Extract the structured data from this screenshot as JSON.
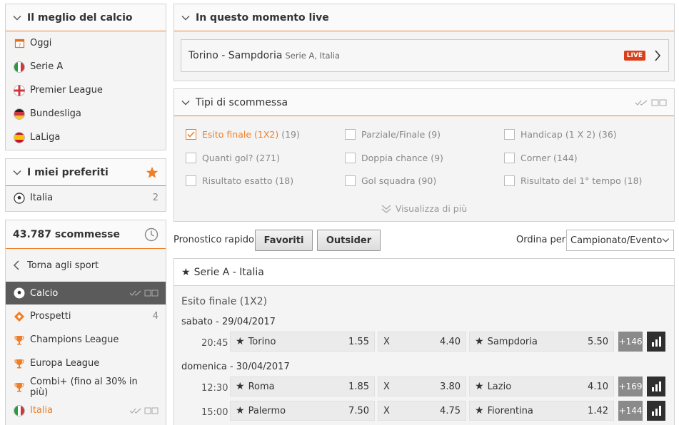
{
  "sidebar": {
    "best": {
      "title": "Il meglio del calcio",
      "items": [
        {
          "label": "Oggi",
          "icon": "calendar-icon"
        },
        {
          "label": "Serie A",
          "icon": "italy-flag-icon"
        },
        {
          "label": "Premier League",
          "icon": "england-flag-icon"
        },
        {
          "label": "Bundesliga",
          "icon": "germany-flag-icon"
        },
        {
          "label": "LaLiga",
          "icon": "spain-flag-icon"
        }
      ]
    },
    "favorites": {
      "title": "I miei preferiti",
      "items": [
        {
          "label": "Italia",
          "count": "2",
          "icon": "soccer-ball-icon"
        }
      ]
    },
    "sports": {
      "title": "43.787 scommesse",
      "back_label": "Torna agli sport",
      "active_label": "Calcio",
      "items": [
        {
          "label": "Prospetti",
          "count": "4",
          "icon": "prospetti-icon"
        },
        {
          "label": "Champions League",
          "count": "",
          "icon": "trophy-icon"
        },
        {
          "label": "Europa League",
          "count": "",
          "icon": "trophy-icon"
        },
        {
          "label": "Combi+ (fino al 30% in più)",
          "count": "",
          "icon": "trophy-icon"
        },
        {
          "label": "Italia",
          "count": "",
          "icon": "italy-flag-icon"
        }
      ]
    }
  },
  "live": {
    "title": "In questo momento live",
    "event": "Torino - Sampdoria",
    "league": "Serie A, Italia",
    "badge": "LIVE"
  },
  "bet_types": {
    "title": "Tipi di scommessa",
    "markets": [
      {
        "label": "Esito finale (1X2)",
        "count": "(19)",
        "checked": true
      },
      {
        "label": "Parziale/Finale",
        "count": "(9)",
        "checked": false
      },
      {
        "label": "Handicap (1 X 2)",
        "count": "(36)",
        "checked": false
      },
      {
        "label": "Quanti gol?",
        "count": "(271)",
        "checked": false
      },
      {
        "label": "Doppia chance",
        "count": "(9)",
        "checked": false
      },
      {
        "label": "Corner",
        "count": "(144)",
        "checked": false
      },
      {
        "label": "Risultato esatto",
        "count": "(18)",
        "checked": false
      },
      {
        "label": "Gol squadra",
        "count": "(90)",
        "checked": false
      },
      {
        "label": "Risultato del 1° tempo",
        "count": "(18)",
        "checked": false
      }
    ],
    "show_more": "Visualizza di più"
  },
  "toolbar": {
    "quick_label": "Pronostico rapido",
    "favorites_btn": "Favoriti",
    "outsider_btn": "Outsider",
    "sort_label": "Ordina per",
    "sort_value": "Campionato/Evento"
  },
  "league_block": {
    "title": "Serie A - Italia",
    "market": "Esito finale (1X2)",
    "days": [
      {
        "date": "sabato - 29/04/2017",
        "matches": [
          {
            "time": "20:45",
            "home": "Torino",
            "home_odd": "1.55",
            "draw": "X",
            "draw_odd": "4.40",
            "away": "Sampdoria",
            "away_odd": "5.50",
            "more": "+146"
          }
        ]
      },
      {
        "date": "domenica - 30/04/2017",
        "matches": [
          {
            "time": "12:30",
            "home": "Roma",
            "home_odd": "1.85",
            "draw": "X",
            "draw_odd": "3.80",
            "away": "Lazio",
            "away_odd": "4.10",
            "more": "+169"
          },
          {
            "time": "15:00",
            "home": "Palermo",
            "home_odd": "7.50",
            "draw": "X",
            "draw_odd": "4.75",
            "away": "Fiorentina",
            "away_odd": "1.42",
            "more": "+144"
          }
        ]
      }
    ]
  },
  "colors": {
    "accent": "#f07e26",
    "live_badge": "#d9401c",
    "active_bg": "#5b5b5b"
  }
}
